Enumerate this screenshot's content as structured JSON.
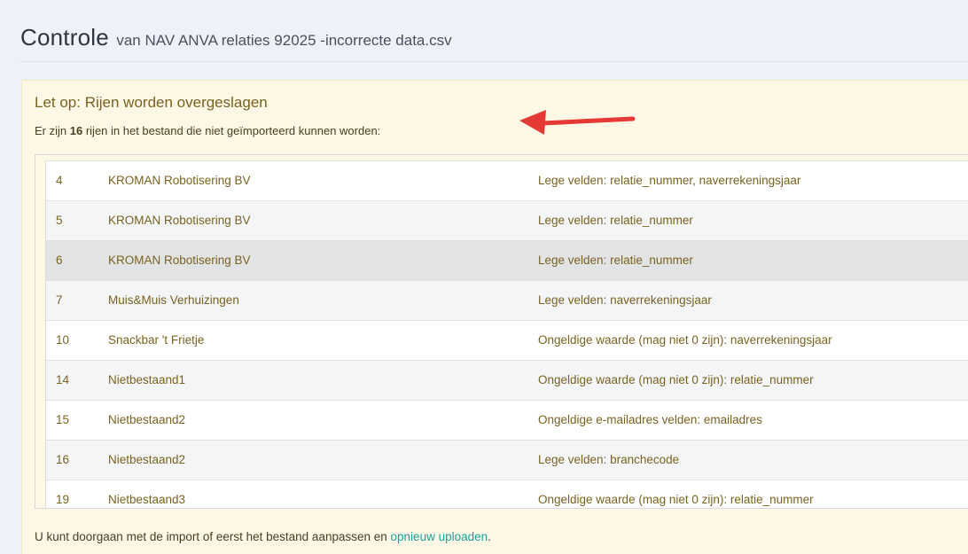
{
  "header": {
    "title": "Controle",
    "subtitle": "van NAV ANVA relaties 92025 -incorrecte data.csv"
  },
  "warning": {
    "title": "Let op: Rijen worden overgeslagen",
    "summary_prefix": "Er zijn",
    "summary_count": "16",
    "summary_suffix": "rijen in het bestand die niet geïmporteerd kunnen worden:",
    "arrow_color": "#e53935"
  },
  "rows": [
    {
      "num": "4",
      "name": "KROMAN Robotisering BV",
      "issue": "Lege velden: relatie_nummer, naverrekeningsjaar"
    },
    {
      "num": "5",
      "name": "KROMAN Robotisering BV",
      "issue": "Lege velden: relatie_nummer"
    },
    {
      "num": "6",
      "name": "KROMAN Robotisering BV",
      "issue": "Lege velden: relatie_nummer"
    },
    {
      "num": "7",
      "name": "Muis&Muis Verhuizingen",
      "issue": "Lege velden: naverrekeningsjaar"
    },
    {
      "num": "10",
      "name": "Snackbar 't Frietje",
      "issue": "Ongeldige waarde (mag niet 0 zijn): naverrekeningsjaar"
    },
    {
      "num": "14",
      "name": "Nietbestaand1",
      "issue": "Ongeldige waarde (mag niet 0 zijn): relatie_nummer"
    },
    {
      "num": "15",
      "name": "Nietbestaand2",
      "issue": "Ongeldige e-mailadres velden: emailadres"
    },
    {
      "num": "16",
      "name": "Nietbestaand2",
      "issue": "Lege velden: branchecode"
    },
    {
      "num": "19",
      "name": "Nietbestaand3",
      "issue": "Ongeldige waarde (mag niet 0 zijn): relatie_nummer"
    }
  ],
  "footer": {
    "text": "U kunt doorgaan met de import of eerst het bestand aanpassen en",
    "link_label": "opnieuw uploaden",
    "end": "."
  },
  "colors": {
    "accent_link": "#1aa39a",
    "warning_bg": "#fdf7e6",
    "warning_text": "#7a6320"
  }
}
